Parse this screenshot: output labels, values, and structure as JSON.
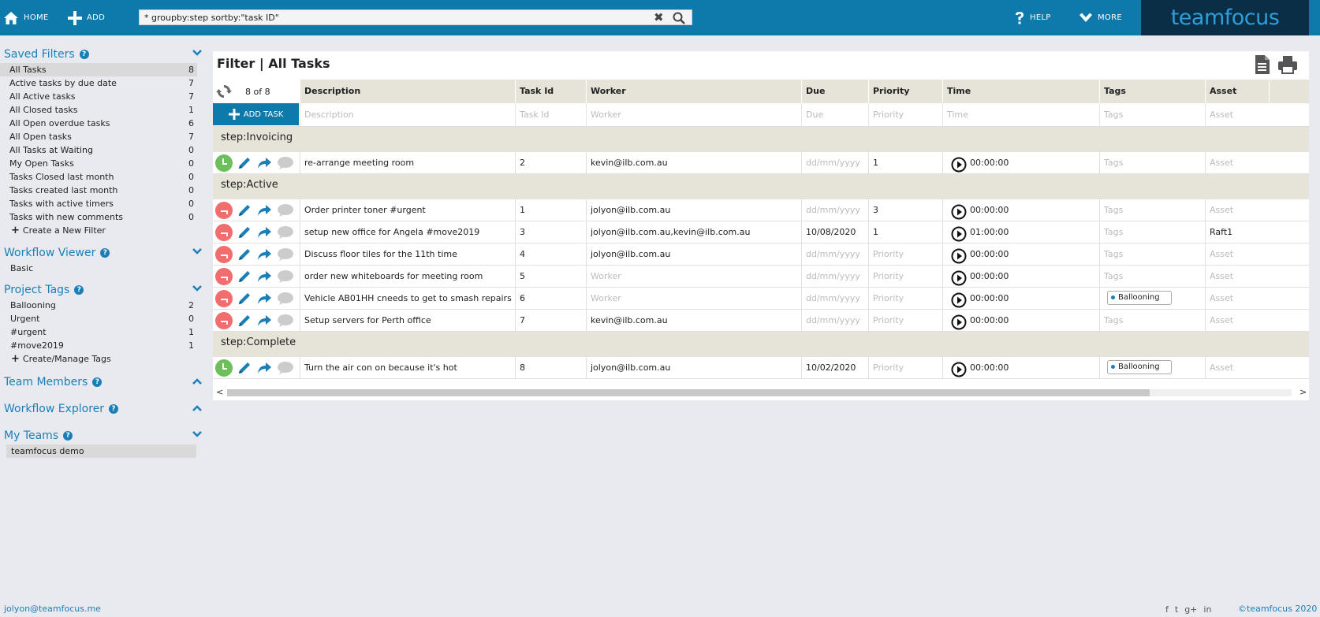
{
  "topbar": {
    "home_label": "HOME",
    "add_label": "ADD",
    "search_value": "* groupby:step sortby:\"task ID\"",
    "clear_symbol": "✖",
    "help_label": "HELP",
    "more_label": "MORE",
    "logo_text": "teamfocus"
  },
  "sidebar": {
    "saved_filters": {
      "title": "Saved Filters",
      "items": [
        {
          "label": "All Tasks",
          "count": "8"
        },
        {
          "label": "Active tasks by due date",
          "count": "7"
        },
        {
          "label": "All Active tasks",
          "count": "7"
        },
        {
          "label": "All Closed tasks",
          "count": "1"
        },
        {
          "label": "All Open overdue tasks",
          "count": "6"
        },
        {
          "label": "All Open tasks",
          "count": "7"
        },
        {
          "label": "All Tasks at Waiting",
          "count": "0"
        },
        {
          "label": "My Open Tasks",
          "count": "0"
        },
        {
          "label": "Tasks Closed last month",
          "count": "0"
        },
        {
          "label": "Tasks created last month",
          "count": "0"
        },
        {
          "label": "Tasks with active timers",
          "count": "0"
        },
        {
          "label": "Tasks with new comments",
          "count": "0"
        }
      ],
      "create_label": "Create a New Filter"
    },
    "workflow_viewer": {
      "title": "Workflow Viewer",
      "items": [
        "Basic"
      ]
    },
    "project_tags": {
      "title": "Project Tags",
      "items": [
        {
          "label": "Ballooning",
          "count": "2"
        },
        {
          "label": "Urgent",
          "count": "0"
        },
        {
          "label": "#urgent",
          "count": "1"
        },
        {
          "label": "#move2019",
          "count": "1"
        }
      ],
      "create_label": "Create/Manage Tags"
    },
    "team_members": {
      "title": "Team Members"
    },
    "workflow_explorer": {
      "title": "Workflow Explorer"
    },
    "my_teams": {
      "title": "My Teams",
      "items": [
        "teamfocus demo"
      ]
    }
  },
  "main": {
    "title": "Filter | All Tasks",
    "count_label": "8 of 8",
    "add_task_label": "ADD TASK",
    "columns": {
      "description": "Description",
      "task_id": "Task Id",
      "worker": "Worker",
      "due": "Due",
      "priority": "Priority",
      "time": "Time",
      "tags": "Tags",
      "asset": "Asset"
    },
    "placeholders": {
      "description": "Description",
      "task_id": "Task Id",
      "worker": "Worker",
      "due": "Due",
      "priority": "Priority",
      "time": "Time",
      "tags": "Tags",
      "asset": "Asset"
    },
    "groups": [
      {
        "label": "step:Invoicing",
        "rows": [
          {
            "status": "green",
            "description": "re-arrange meeting room",
            "task_id": "2",
            "worker": "kevin@ilb.com.au",
            "due": "dd/mm/yyyy",
            "priority": "1",
            "time": "00:00:00",
            "tags": "Tags",
            "tag_chip": "",
            "asset": "Asset"
          }
        ]
      },
      {
        "label": "step:Active",
        "rows": [
          {
            "status": "red",
            "description": "Order printer toner #urgent",
            "task_id": "1",
            "worker": "jolyon@ilb.com.au",
            "due": "dd/mm/yyyy",
            "priority": "3",
            "time": "00:00:00",
            "tags": "Tags",
            "tag_chip": "",
            "asset": "Asset"
          },
          {
            "status": "red",
            "description": "setup new office for Angela #move2019",
            "task_id": "3",
            "worker": "jolyon@ilb.com.au,kevin@ilb.com.au",
            "due": "10/08/2020",
            "priority": "1",
            "time": "01:00:00",
            "tags": "Tags",
            "tag_chip": "",
            "asset": "Raft1"
          },
          {
            "status": "red",
            "description": "Discuss floor tiles for the 11th time",
            "task_id": "4",
            "worker": "jolyon@ilb.com.au",
            "due": "dd/mm/yyyy",
            "priority": "Priority",
            "time": "00:00:00",
            "tags": "Tags",
            "tag_chip": "",
            "asset": "Asset"
          },
          {
            "status": "red",
            "description": "order new whiteboards for meeting room",
            "task_id": "5",
            "worker": "Worker",
            "due": "dd/mm/yyyy",
            "priority": "Priority",
            "time": "00:00:00",
            "tags": "Tags",
            "tag_chip": "",
            "asset": "Asset"
          },
          {
            "status": "red",
            "description": "Vehicle AB01HH cneeds to get to smash repairs",
            "task_id": "6",
            "worker": "Worker",
            "due": "dd/mm/yyyy",
            "priority": "Priority",
            "time": "00:00:00",
            "tags": "",
            "tag_chip": "Ballooning",
            "asset": "Asset"
          },
          {
            "status": "red",
            "description": "Setup servers for Perth office",
            "task_id": "7",
            "worker": "kevin@ilb.com.au",
            "due": "dd/mm/yyyy",
            "priority": "Priority",
            "time": "00:00:00",
            "tags": "Tags",
            "tag_chip": "",
            "asset": "Asset"
          }
        ]
      },
      {
        "label": "step:Complete",
        "rows": [
          {
            "status": "green",
            "description": "Turn the air con on because it's hot",
            "task_id": "8",
            "worker": "jolyon@ilb.com.au",
            "due": "10/02/2020",
            "priority": "Priority",
            "time": "00:00:00",
            "tags": "",
            "tag_chip": "Ballooning",
            "asset": "Asset"
          }
        ]
      }
    ]
  },
  "footer": {
    "user": "jolyon@teamfocus.me",
    "social": [
      "f",
      "t",
      "g+",
      "in"
    ],
    "copyright": "©teamfocus 2020"
  },
  "colors": {
    "brand_blue": "#0e7aab",
    "logo_bg": "#0a2e45",
    "status_open": "#f26d6d",
    "status_closed": "#6cbf5b",
    "header_bg": "#e6e3d9"
  }
}
